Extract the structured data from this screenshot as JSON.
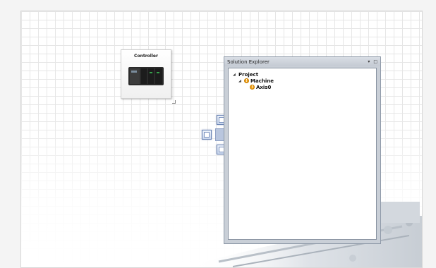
{
  "controller": {
    "title": "Controller",
    "icon": "plc-device-icon"
  },
  "solution_explorer": {
    "title": "Solution Explorer",
    "pin_icon": "▾",
    "close_icon": "□",
    "tree": [
      {
        "label": "Project",
        "level": 0,
        "expanded": true,
        "warning": false
      },
      {
        "label": "Machine",
        "level": 1,
        "expanded": true,
        "warning": true
      },
      {
        "label": "Axis0",
        "level": 2,
        "expanded": false,
        "warning": true
      }
    ]
  },
  "dock_guide": {
    "icon": "docking-guide-icon"
  },
  "colors": {
    "accent_blue": "#6b85b5",
    "warning": "#f0a31c",
    "panel_border": "#8e99a8"
  }
}
